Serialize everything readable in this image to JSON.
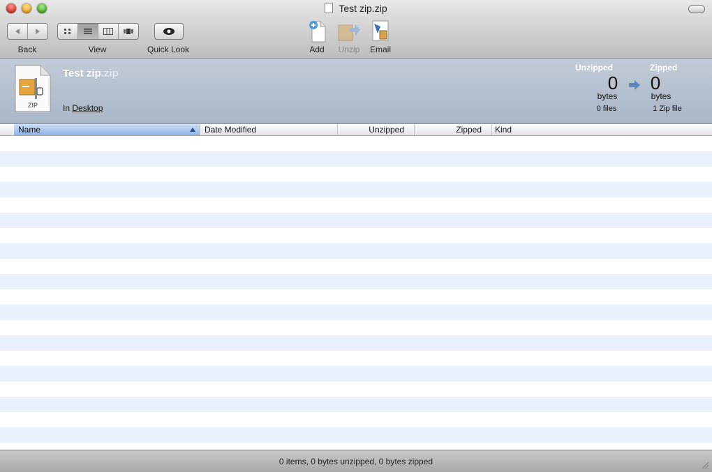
{
  "window": {
    "title": "Test zip.zip"
  },
  "toolbar": {
    "back_label": "Back",
    "view_label": "View",
    "quicklook_label": "Quick Look",
    "add_label": "Add",
    "unzip_label": "Unzip",
    "email_label": "Email",
    "view_modes": [
      "icon-view-icon",
      "list-view-icon",
      "column-view-icon",
      "coverflow-view-icon"
    ],
    "active_view": "list-view-icon"
  },
  "archive": {
    "icon_label": "ZIP",
    "name_base": "Test zip",
    "name_ext": ".zip",
    "location_prefix": "In",
    "location": "Desktop"
  },
  "stats": {
    "unzipped": {
      "heading": "Unzipped",
      "value": "0",
      "unit": "bytes",
      "sub": "0 files"
    },
    "zipped": {
      "heading": "Zipped",
      "value": "0",
      "unit": "bytes",
      "sub": "1 Zip file"
    }
  },
  "list": {
    "columns": [
      "Name",
      "Date Modified",
      "Unzipped",
      "Zipped",
      "Kind"
    ],
    "sorted_column": "Name",
    "rows": []
  },
  "status": {
    "text": "0 items, 0 bytes unzipped, 0 bytes zipped"
  },
  "colors": {
    "panel": "#b4c0cf",
    "stripe": "#e9f0fb",
    "sort_highlight": "#8eb3e6"
  }
}
